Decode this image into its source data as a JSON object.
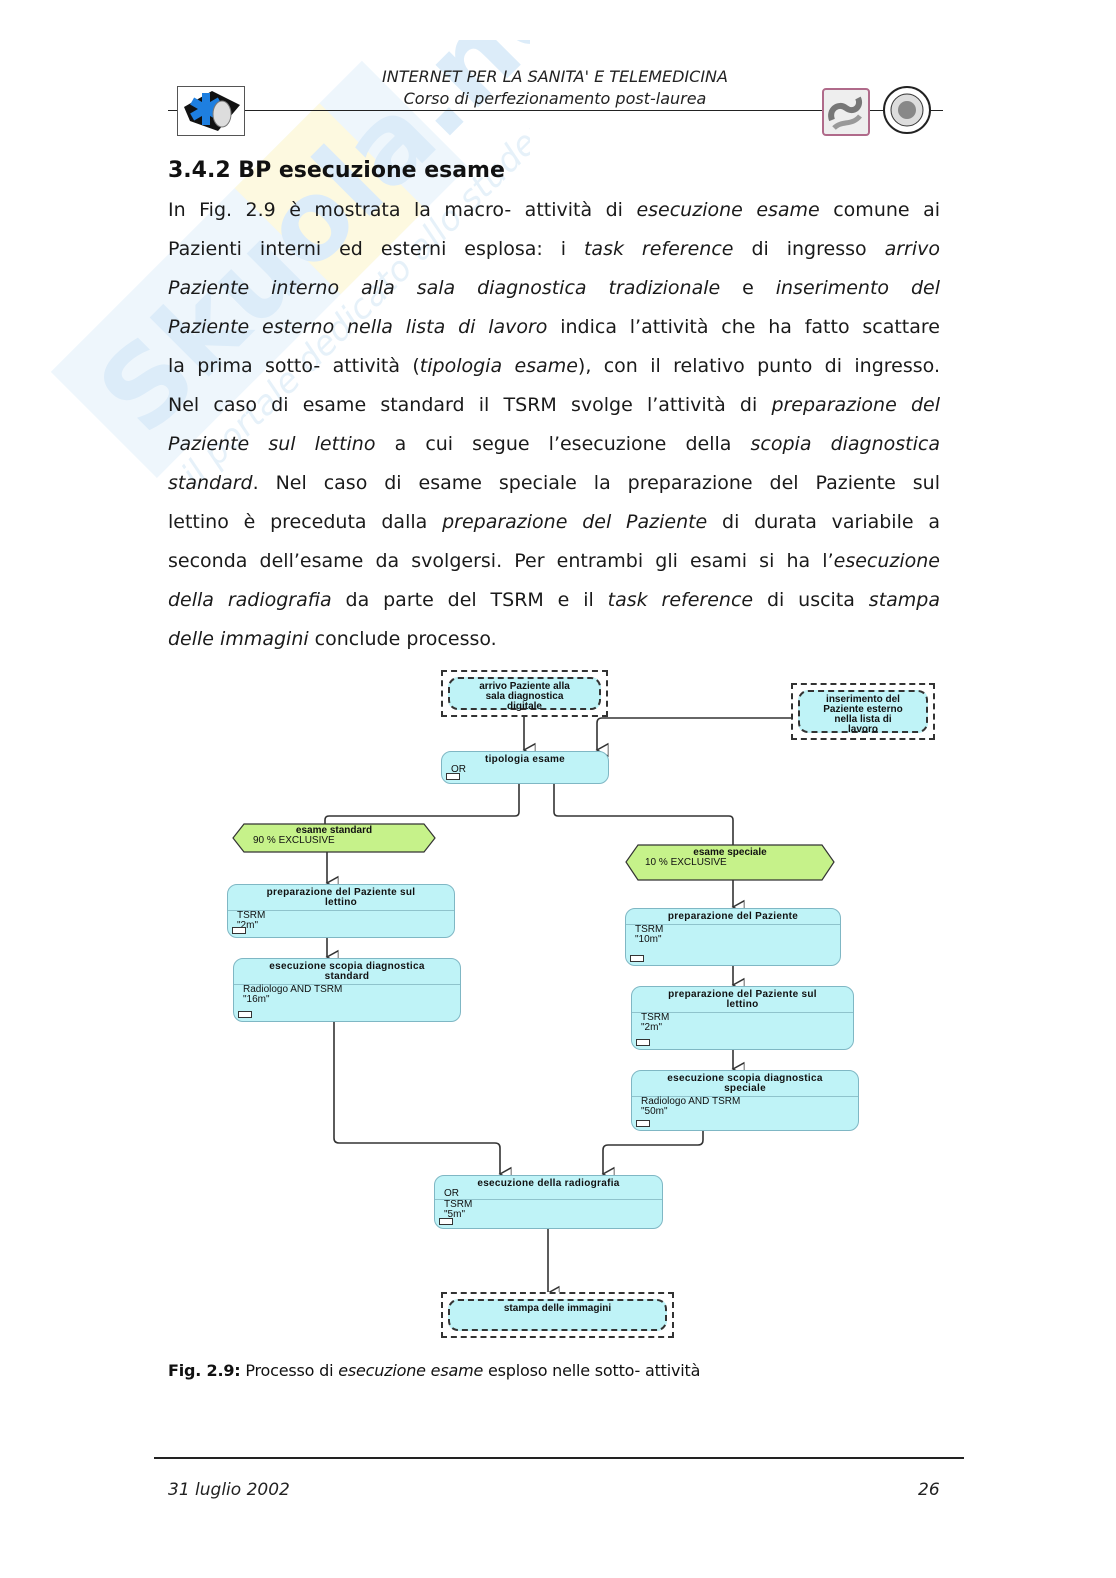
{
  "watermark": {
    "brand": "Skuola.net",
    "tagline": "il portale dedicato allo studente"
  },
  "header": {
    "title": "INTERNET PER LA SANITA' E TELEMEDICINA",
    "subtitle": "Corso di perfezionamento post-laurea",
    "logos": [
      "star-of-life-logo",
      "institution-logo",
      "university-seal-logo"
    ]
  },
  "section": {
    "title": "3.4.2 BP esecuzione esame",
    "lines": [
      [
        {
          "t": "In Fig. 2.9 è mostrata la macro- attività di "
        },
        {
          "t": "esecuzione esame",
          "i": true
        },
        {
          "t": " comune ai"
        }
      ],
      [
        {
          "t": "Pazienti interni ed esterni esplosa: i "
        },
        {
          "t": "task reference",
          "i": true
        },
        {
          "t": " di ingresso "
        },
        {
          "t": "arrivo",
          "i": true
        }
      ],
      [
        {
          "t": "Paziente interno alla sala diagnostica tradizionale",
          "i": true
        },
        {
          "t": " e "
        },
        {
          "t": "inserimento del",
          "i": true
        }
      ],
      [
        {
          "t": "Paziente esterno nella lista di lavoro",
          "i": true
        },
        {
          "t": " indica l’attività che ha fatto scattare"
        }
      ],
      [
        {
          "t": "la prima sotto- attività ("
        },
        {
          "t": "tipologia esame",
          "i": true
        },
        {
          "t": "), con il relativo punto di ingresso."
        }
      ],
      [
        {
          "t": "Nel caso di esame standard il TSRM svolge l’attività di "
        },
        {
          "t": "preparazione del",
          "i": true
        }
      ],
      [
        {
          "t": "Paziente sul lettino",
          "i": true
        },
        {
          "t": " a cui segue l’esecuzione della "
        },
        {
          "t": "scopia diagnostica",
          "i": true
        }
      ],
      [
        {
          "t": "standard",
          "i": true
        },
        {
          "t": ". Nel caso di esame speciale la preparazione del Paziente sul"
        }
      ],
      [
        {
          "t": "lettino è preceduta dalla "
        },
        {
          "t": "preparazione del Paziente",
          "i": true
        },
        {
          "t": " di durata variabile a"
        }
      ],
      [
        {
          "t": "seconda dell’esame da svolgersi. Per entrambi gli esami si ha l’"
        },
        {
          "t": "esecuzione",
          "i": true
        }
      ],
      [
        {
          "t": "della radiografia",
          "i": true
        },
        {
          "t": " da parte del TSRM e il "
        },
        {
          "t": "task reference",
          "i": true
        },
        {
          "t": " di uscita "
        },
        {
          "t": "stampa",
          "i": true
        }
      ],
      [
        {
          "t": "delle immagini",
          "i": true
        },
        {
          "t": " conclude processo."
        }
      ]
    ]
  },
  "diagram": {
    "task_references": {
      "arrivo": [
        "arrivo Paziente alla",
        "sala diagnostica",
        "digitale"
      ],
      "inserimento": [
        "inserimento del",
        "Paziente esterno",
        "nella lista di",
        "lavoro"
      ],
      "stampa": [
        "stampa delle immagini"
      ]
    },
    "nodes": {
      "tipologia": {
        "title": [
          "tipologia esame"
        ],
        "lines": [
          "OR"
        ]
      },
      "prep_lettino_std": {
        "title": [
          "preparazione del Paziente sul",
          "lettino"
        ],
        "lines": [
          "TSRM",
          "\"2m\""
        ]
      },
      "scopia_std": {
        "title": [
          "esecuzione scopia diagnostica",
          "standard"
        ],
        "lines": [
          "Radiologo AND TSRM",
          "\"16m\""
        ]
      },
      "prep_paziente": {
        "title": [
          "preparazione del Paziente"
        ],
        "lines": [
          "TSRM",
          "\"10m\""
        ]
      },
      "prep_lettino_spec": {
        "title": [
          "preparazione del Paziente sul",
          "lettino"
        ],
        "lines": [
          "TSRM",
          "\"2m\""
        ]
      },
      "scopia_spec": {
        "title": [
          "esecuzione scopia diagnostica",
          "speciale"
        ],
        "lines": [
          "Radiologo AND TSRM",
          "\"50m\""
        ]
      },
      "radiografia": {
        "title": [
          "esecuzione della radiografia"
        ],
        "lines": [
          "OR",
          "TSRM",
          "\"5m\""
        ]
      }
    },
    "decisions": {
      "standard": {
        "title": "esame standard",
        "line": "90 % EXCLUSIVE",
        "probability": 90
      },
      "speciale": {
        "title": "esame speciale",
        "line": "10 % EXCLUSIVE",
        "probability": 10
      }
    },
    "colors": {
      "activity_fill": "#bff3f7",
      "decision_fill": "#c6f28a",
      "line": "#333333"
    }
  },
  "caption": {
    "label": "Fig. 2.9:",
    "pre": " Processo di ",
    "italic": "esecuzione esame",
    "post": " esploso nelle sotto- attività"
  },
  "footer": {
    "date": "31 luglio 2002",
    "page": "26"
  }
}
